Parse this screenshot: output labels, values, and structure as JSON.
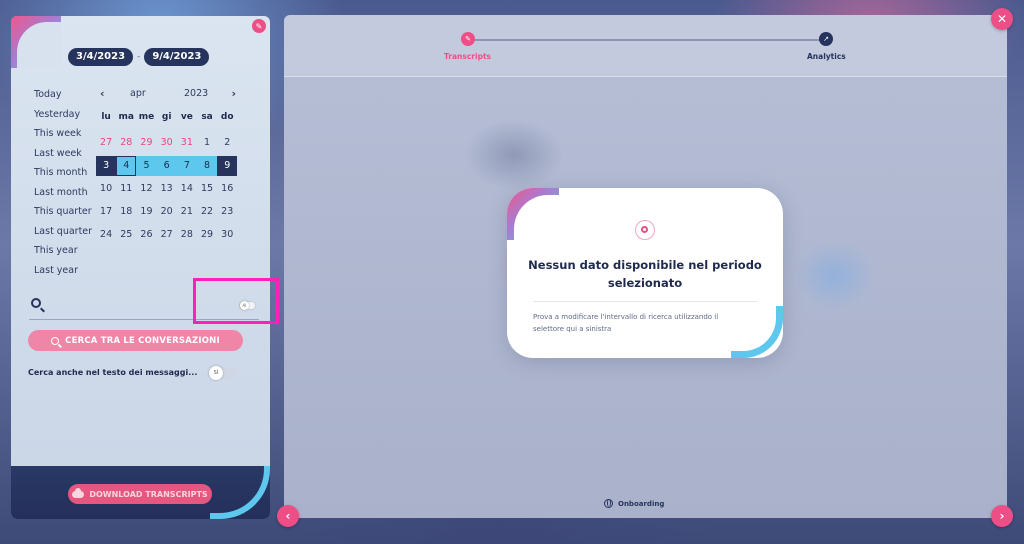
{
  "date_range": {
    "start": "3/4/2023",
    "end": "9/4/2023",
    "separator": "-"
  },
  "presets": [
    "Today",
    "Yesterday",
    "This week",
    "Last week",
    "This month",
    "Last month",
    "This quarter",
    "Last quarter",
    "This year",
    "Last year"
  ],
  "calendar": {
    "month": "apr",
    "year": "2023",
    "prev_symbol": "‹",
    "next_symbol": "›",
    "weekdays": [
      "lu",
      "ma",
      "me",
      "gi",
      "ve",
      "sa",
      "do"
    ],
    "weeks": [
      [
        {
          "d": "27",
          "other": true
        },
        {
          "d": "28",
          "other": true
        },
        {
          "d": "29",
          "other": true
        },
        {
          "d": "30",
          "other": true
        },
        {
          "d": "31",
          "other": true
        },
        {
          "d": "1"
        },
        {
          "d": "2"
        }
      ],
      [
        {
          "d": "3",
          "edge": true
        },
        {
          "d": "4",
          "range": true,
          "today": true
        },
        {
          "d": "5",
          "range": true
        },
        {
          "d": "6",
          "range": true
        },
        {
          "d": "7",
          "range": true
        },
        {
          "d": "8",
          "range": true
        },
        {
          "d": "9",
          "edge": true
        }
      ],
      [
        {
          "d": "10"
        },
        {
          "d": "11"
        },
        {
          "d": "12"
        },
        {
          "d": "13"
        },
        {
          "d": "14"
        },
        {
          "d": "15"
        },
        {
          "d": "16"
        }
      ],
      [
        {
          "d": "17"
        },
        {
          "d": "18"
        },
        {
          "d": "19"
        },
        {
          "d": "20"
        },
        {
          "d": "21"
        },
        {
          "d": "22"
        },
        {
          "d": "23"
        }
      ],
      [
        {
          "d": "24"
        },
        {
          "d": "25"
        },
        {
          "d": "26"
        },
        {
          "d": "27"
        },
        {
          "d": "28"
        },
        {
          "d": "29"
        },
        {
          "d": "30"
        }
      ]
    ]
  },
  "search": {
    "value": "",
    "placeholder": "",
    "mini_toggle_label": "AI"
  },
  "cerca_button_label": "CERCA TRA LE CONVERSAZIONI",
  "cerca_text": {
    "label": "Cerca anche nel testo dei messaggi...",
    "toggle_label": "SÌ"
  },
  "download_button_label": "DOWNLOAD TRANSCRIPTS",
  "stepper": {
    "steps": [
      {
        "label": "Transcripts",
        "icon": "pencil-icon",
        "active": true
      },
      {
        "label": "Analytics",
        "icon": "trend-icon",
        "active": false
      }
    ]
  },
  "empty_state": {
    "title": "Nessun dato disponibile nel periodo selezionato",
    "description": "Prova a modificare l'intervallo di ricerca utilizzando il selettore qui a sinistra"
  },
  "onboarding_label": "Onboarding",
  "colors": {
    "accent_pink": "#ee4e86",
    "accent_blue": "#5ec7ee",
    "navy": "#26335c",
    "highlight": "#ff1fbf"
  }
}
